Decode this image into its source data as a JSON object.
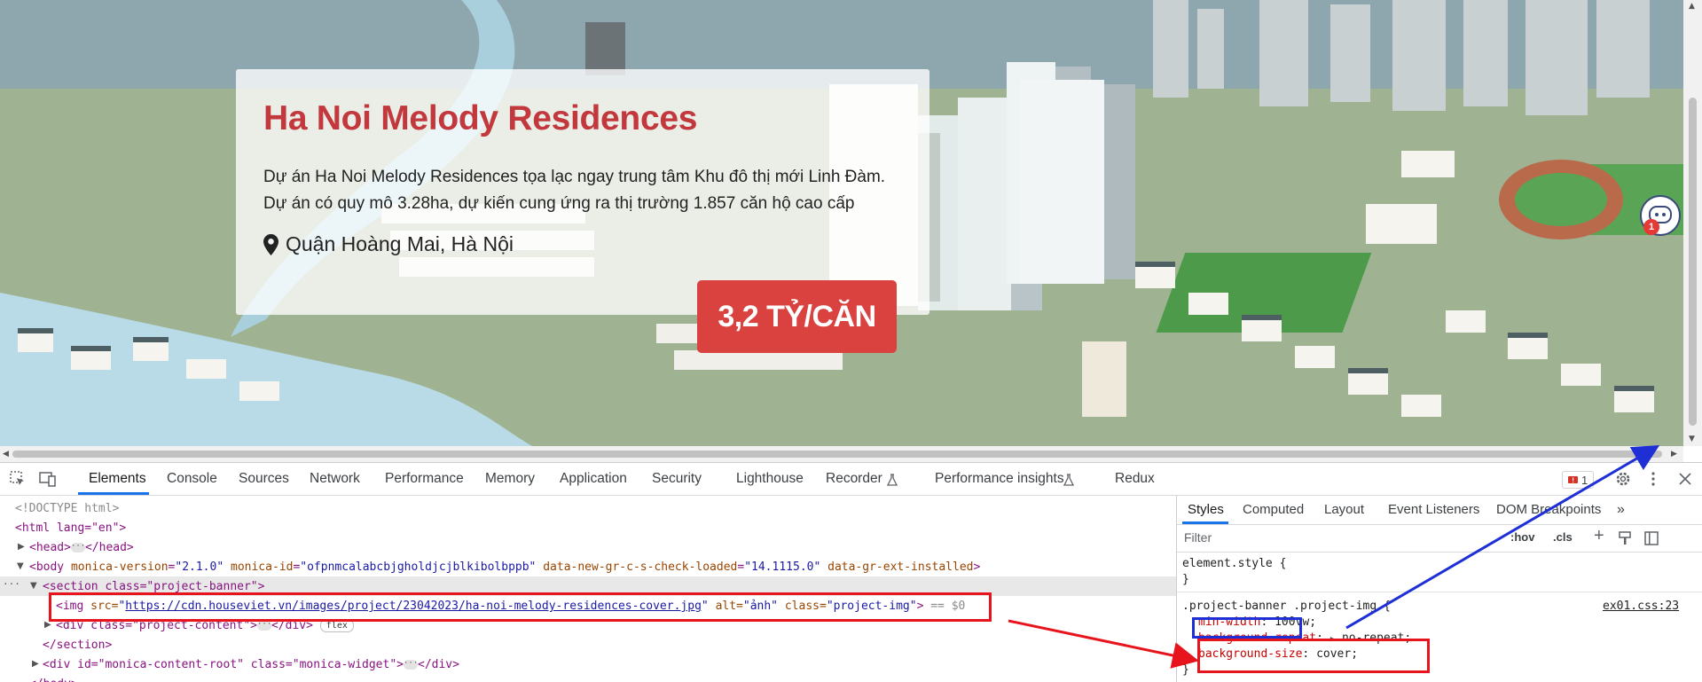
{
  "page": {
    "title": "Ha Noi Melody Residences",
    "description_line1": "Dự án Ha Noi Melody Residences tọa lạc ngay trung tâm Khu đô thị mới Linh Đàm.",
    "description_line2": "Dự án có quy mô 3.28ha, dự kiến cung ứng ra thị trường 1.857 căn hộ cao cấp",
    "location": "Quận Hoàng Mai, Hà Nội",
    "price": "3,2 TỶ/CĂN",
    "widget_badge": "1",
    "colors": {
      "title": "#c2383d",
      "price_bg": "#d9423f"
    }
  },
  "devtools": {
    "tabs": [
      "Elements",
      "Console",
      "Sources",
      "Network",
      "Performance",
      "Memory",
      "Application",
      "Security",
      "Lighthouse",
      "Recorder",
      "Performance insights",
      "Redux"
    ],
    "active_tab": "Elements",
    "issues_count": "1",
    "dom": {
      "doctype": "<!DOCTYPE html>",
      "html_open": "<html lang=\"en\">",
      "head": "<head>",
      "head_close": "</head>",
      "body_tag": "<body",
      "body_attr1_name": "monica-version",
      "body_attr1_value": "\"2.1.0\"",
      "body_attr2_name": "monica-id",
      "body_attr2_value": "\"ofpnmcalabcbjgholdjcjblkibolbppb\"",
      "body_attr3_name": "data-new-gr-c-s-check-loaded",
      "body_attr3_value": "\"14.1115.0\"",
      "body_attr4_name": "data-gr-ext-installed",
      "section_open": "<section class=\"project-banner\">",
      "img_tag": "<img",
      "img_src_name": "src=",
      "img_src_value": "https://cdn.houseviet.vn/images/project/23042023/ha-noi-melody-residences-cover.jpg",
      "img_alt_name": "alt=",
      "img_alt_value": "\"ảnh\"",
      "img_class_name": "class=",
      "img_class_value": "\"project-img\"",
      "img_suffix": "== $0",
      "div_content": "<div class=\"project-content\">",
      "div_close": "</div>",
      "flex_badge": "flex",
      "section_close": "</section>",
      "monica_div": "<div id=\"monica-content-root\" class=\"monica-widget\">",
      "body_close": "</body>"
    },
    "styles": {
      "sub_tabs": [
        "Styles",
        "Computed",
        "Layout",
        "Event Listeners",
        "DOM Breakpoints"
      ],
      "filter_placeholder": "Filter",
      "hov": ":hov",
      "cls": ".cls",
      "element_style": "element.style {",
      "close_brace": "}",
      "rule_selector": ".project-banner .project-img {",
      "rule_source": "ex01.css:23",
      "decl1_prop": "min-width",
      "decl1_value": "100vw;",
      "decl2_prop": "background-repeat",
      "decl2_value": "no-repeat;",
      "decl3_prop": "background-size",
      "decl3_value": "cover;"
    }
  }
}
